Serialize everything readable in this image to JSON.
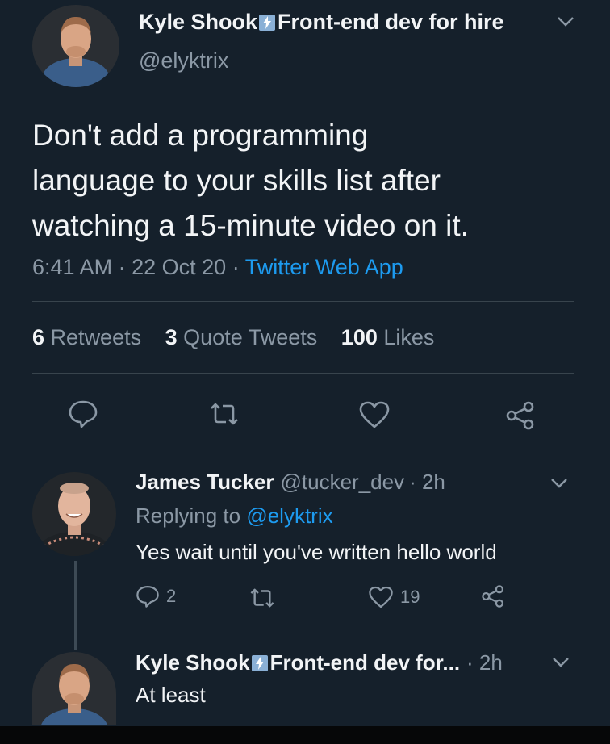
{
  "main_tweet": {
    "author_name": "Kyle Shook",
    "author_bio": "Front-end dev for hire",
    "handle": "@elyktrix",
    "text_lines": [
      "Don't add a programming",
      "language to your skills list after",
      "watching a 15-minute video on it."
    ],
    "time": "6:41 AM",
    "date": "22 Oct 20",
    "separator": "·",
    "source": "Twitter Web App",
    "stats": {
      "retweets_count": "6",
      "retweets_label": "Retweets",
      "quotes_count": "3",
      "quotes_label": "Quote Tweets",
      "likes_count": "100",
      "likes_label": "Likes"
    }
  },
  "reply": {
    "author_name": "James Tucker",
    "handle": "@tucker_dev",
    "time": "· 2h",
    "replying_prefix": "Replying to",
    "replying_handle": "@elyktrix",
    "text": "Yes wait until you've written hello world",
    "reply_count": "2",
    "like_count": "19"
  },
  "reply2": {
    "author_name": "Kyle Shook",
    "author_bio_truncated": "Front-end dev for...",
    "time": "· 2h",
    "text": "At least"
  },
  "icons": {
    "reply": "speech-bubble-icon",
    "retweet": "retweet-icon",
    "like": "heart-icon",
    "share": "share-icon",
    "more": "chevron-down-icon",
    "badge": "lightning-bolt-icon"
  },
  "colors": {
    "background": "#15202b",
    "link": "#1d9bf0",
    "muted": "#8b98a5",
    "divider": "#38444d"
  }
}
